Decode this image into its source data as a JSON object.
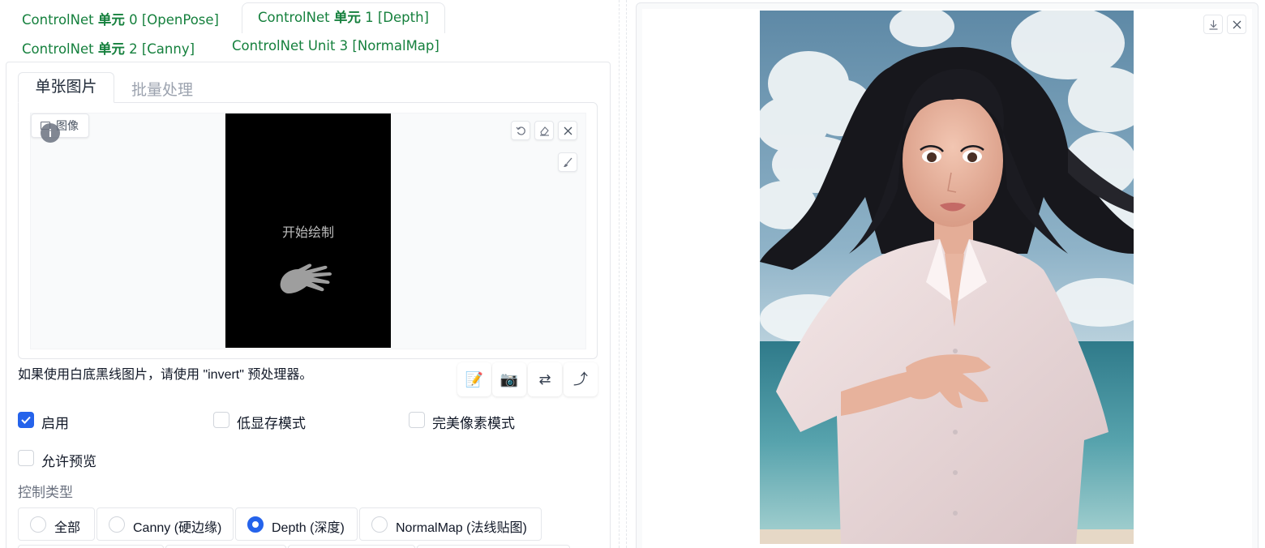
{
  "unit_tabs": [
    {
      "prefix": "ControlNet ",
      "bold": "单元",
      "suffix": " 0 [OpenPose]"
    },
    {
      "prefix": "ControlNet ",
      "bold": "单元",
      "suffix": " 1 [Depth]"
    },
    {
      "prefix": "ControlNet ",
      "bold": "单元",
      "suffix": " 2 [Canny]"
    },
    {
      "prefix": "ControlNet Unit 3 [NormalMap]",
      "bold": "",
      "suffix": ""
    }
  ],
  "mode_tabs": {
    "single": "单张图片",
    "batch": "批量处理"
  },
  "image_box": {
    "label": "图像",
    "info": "i",
    "canvas_text": "开始绘制"
  },
  "hint": "如果使用白底黑线图片，请使用 \"invert\" 预处理器。",
  "action_buttons": {
    "edit": "📝",
    "camera": "📷",
    "swap": "⇄",
    "send": "⤴"
  },
  "checkboxes": {
    "enable": {
      "label": "启用",
      "checked": true
    },
    "low_vram": {
      "label": "低显存模式",
      "checked": false
    },
    "pixel_perfect": {
      "label": "完美像素模式",
      "checked": false
    },
    "allow_preview": {
      "label": "允许预览",
      "checked": false
    }
  },
  "control_type": {
    "label": "控制类型",
    "options": [
      "全部",
      "Canny (硬边缘)",
      "Depth (深度)",
      "NormalMap (法线贴图)"
    ],
    "selected": "Depth (深度)"
  },
  "colors": {
    "tab_green": "#15803d",
    "accent_blue": "#2563eb"
  },
  "icons": [
    "undo-icon",
    "eraser-icon",
    "close-icon",
    "brush-icon",
    "download-icon",
    "close-icon"
  ]
}
